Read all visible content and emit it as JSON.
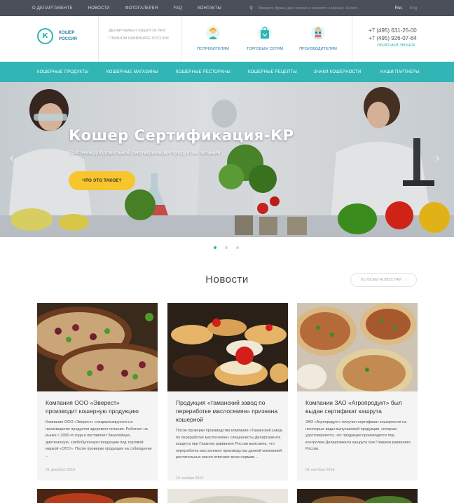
{
  "topbar": {
    "links": [
      "О ДЕПАРТАМЕНТЕ",
      "НОВОСТИ",
      "ФОТОГАЛЕРЕЯ",
      "FAQ",
      "КОНТАКТЫ"
    ],
    "search_placeholder": "Введите фразы для поиска и нажмите клавишу «Enter»",
    "lang_ru": "Rus",
    "lang_en": "Eng"
  },
  "header": {
    "logo_line1": "КОШЕР",
    "logo_line2": "РОССИЯ",
    "dept_text": "ДЕПАРТАМЕНТ КАШРУТА ПРИ ГЛАВНОМ РАВВИНАТЕ РОССИИ",
    "categories": [
      "ПОТРЕБИТЕЛЯМ",
      "ТОРГОВЫМ СЕТЯМ",
      "ПРОИЗВОДИТЕЛЯМ"
    ],
    "phone1": "+7 (495) 631-25-00",
    "phone2": "+7 (495) 926-07-84",
    "callback": "ОБРАТНЫЙ ЗВОНОК"
  },
  "mainnav": [
    "КОШЕРНЫЕ ПРОДУКТЫ",
    "КОШЕРНЫЕ МАГАЗИНЫ",
    "КОШЕРНЫЕ РЕСТОРАНЫ",
    "КОШЕРНЫЕ РЕЦЕПТЫ",
    "ЗНАКИ КОШЕРНОСТИ",
    "НАШИ ПАРТНЕРЫ"
  ],
  "hero": {
    "title": "Кошер Сертификация-КР",
    "subtitle": "Система добровольной сертификации продуктов питания",
    "button": "ЧТО ЭТО ТАКОЕ?",
    "slide_count": 3,
    "active_slide": 1
  },
  "news": {
    "title": "Новости",
    "all_news": "КО ВСЕМ НОВОСТЯМ",
    "cards": [
      {
        "title": "Компания ООО «Эверест» производит кошерную продукцию",
        "text": "Компания ООО «Эверест» специализируется на производстве продуктов здорового питания. Работает на рынке с 2000-го года и поставляет бакалейную, диетическую, хлебобулочную продукцию под торговой маркой «ОГО!». После проверки продукция на соблюдение ...",
        "date": "21 декабря 2016"
      },
      {
        "title": "Продукция «таманский завод по переработке маслосемян» признана кошерной",
        "text": "После проверки производства компании «Таманский завод по переработке маслосемян» специалисты Департамента кашрута при Главном раввинате России выяснили, что переработка маслосемян производства данной компанией растительных масел отвечает всем нормам ...",
        "date": "19 ноября 2016"
      },
      {
        "title": "Компании ЗАО «Агропродукт» был выдан сертификат кашрута",
        "text": "ЗАО «Агропродукт» получил сертификат кошерности на некоторые виды выпускаемой продукции, которым удостоверяется, что продукция производится под контролем Департамента кашрута при Главном раввинате России.",
        "date": "01 октября 2016"
      }
    ]
  },
  "colors": {
    "teal": "#31b6b5",
    "topbar": "#4b4f5a",
    "button_yellow": "#f7c52c",
    "link_blue": "#2b7fb0"
  }
}
